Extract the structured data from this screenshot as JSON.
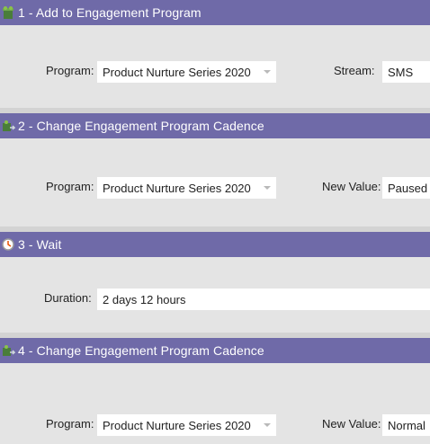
{
  "steps": [
    {
      "title": "1 - Add to Engagement Program",
      "icon": "engagement-program-icon",
      "fields": [
        {
          "label": "Program:",
          "value": "Product Nurture Series 2020",
          "type": "dropdown"
        },
        {
          "label": "Stream:",
          "value": "SMS",
          "type": "text"
        }
      ]
    },
    {
      "title": "2 - Change Engagement Program Cadence",
      "icon": "engagement-cadence-icon",
      "fields": [
        {
          "label": "Program:",
          "value": "Product Nurture Series 2020",
          "type": "dropdown"
        },
        {
          "label": "New Value:",
          "value": "Paused",
          "type": "text"
        }
      ]
    },
    {
      "title": "3 - Wait",
      "icon": "clock-icon",
      "fields": [
        {
          "label": "Duration:",
          "value": "2 days 12 hours",
          "type": "text"
        }
      ]
    },
    {
      "title": "4 - Change Engagement Program Cadence",
      "icon": "engagement-cadence-icon",
      "fields": [
        {
          "label": "Program:",
          "value": "Product Nurture Series 2020",
          "type": "dropdown"
        },
        {
          "label": "New Value:",
          "value": "Normal",
          "type": "text"
        }
      ]
    }
  ],
  "colors": {
    "header": "#6f6aa8",
    "panel": "#e4e4e4",
    "separator": "#d3d3d3"
  }
}
